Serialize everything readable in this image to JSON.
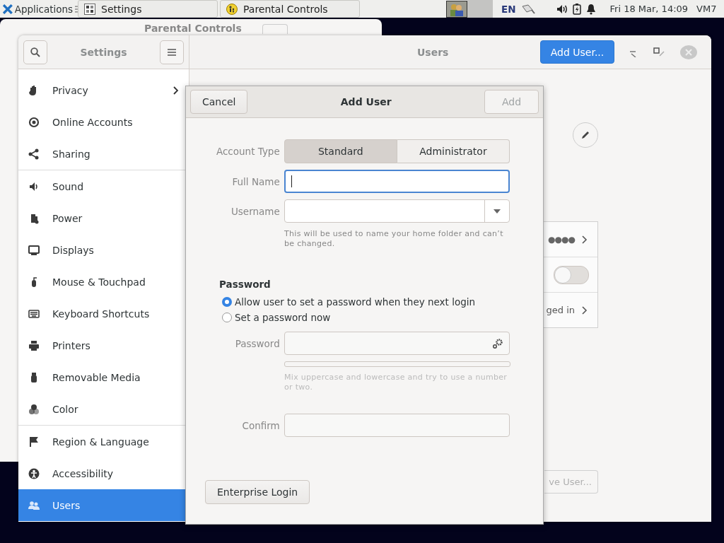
{
  "top_panel": {
    "applications": "Applications",
    "tasks": [
      {
        "label": "Settings",
        "selected": false
      },
      {
        "label": "Parental Controls",
        "selected": false
      }
    ],
    "keyboard_layout": "EN",
    "clock": "Fri 18 Mar, 14:09",
    "host": "VM7"
  },
  "background_window": {
    "title": "Parental Controls"
  },
  "settings_window": {
    "sidebar_title": "Settings",
    "page_title": "Users",
    "add_user_button": "Add User...",
    "sidebar_groups": [
      [
        {
          "label": "Privacy",
          "submenu": true,
          "selected": false
        },
        {
          "label": "Online Accounts",
          "submenu": false,
          "selected": false
        },
        {
          "label": "Sharing",
          "submenu": false,
          "selected": false
        }
      ],
      [
        {
          "label": "Sound",
          "submenu": false,
          "selected": false
        },
        {
          "label": "Power",
          "submenu": false,
          "selected": false
        },
        {
          "label": "Displays",
          "submenu": false,
          "selected": false
        },
        {
          "label": "Mouse & Touchpad",
          "submenu": false,
          "selected": false
        },
        {
          "label": "Keyboard Shortcuts",
          "submenu": false,
          "selected": false
        },
        {
          "label": "Printers",
          "submenu": false,
          "selected": false
        },
        {
          "label": "Removable Media",
          "submenu": false,
          "selected": false
        },
        {
          "label": "Color",
          "submenu": false,
          "selected": false
        }
      ],
      [
        {
          "label": "Region & Language",
          "submenu": false,
          "selected": false
        },
        {
          "label": "Accessibility",
          "submenu": false,
          "selected": false
        },
        {
          "label": "Users",
          "submenu": false,
          "selected": true
        }
      ]
    ],
    "user_panel": {
      "password_value": "●●●●",
      "auto_login": {
        "on": false
      },
      "logged_in_text": "ged in",
      "remove_button": {
        "label": "ve User...",
        "disabled": true
      }
    }
  },
  "dialog": {
    "title": "Add User",
    "cancel": "Cancel",
    "add": {
      "label": "Add",
      "disabled": true
    },
    "account_type": {
      "label": "Account Type",
      "options": [
        {
          "label": "Standard",
          "selected": true
        },
        {
          "label": "Administrator",
          "selected": false
        }
      ]
    },
    "full_name": {
      "label": "Full Name",
      "focused": true
    },
    "username": {
      "label": "Username",
      "hint": "This will be used to name your home folder and can’t be changed."
    },
    "password_heading": "Password",
    "password_options": [
      {
        "label": "Allow user to set a password when they next login",
        "selected": true
      },
      {
        "label": "Set a password now",
        "selected": false
      }
    ],
    "password": {
      "label": "Password",
      "strength": {
        "level": 0
      },
      "hint": "Mix uppercase and lowercase and try to use a number or two."
    },
    "confirm": {
      "label": "Confirm"
    },
    "enterprise_login": "Enterprise Login"
  }
}
